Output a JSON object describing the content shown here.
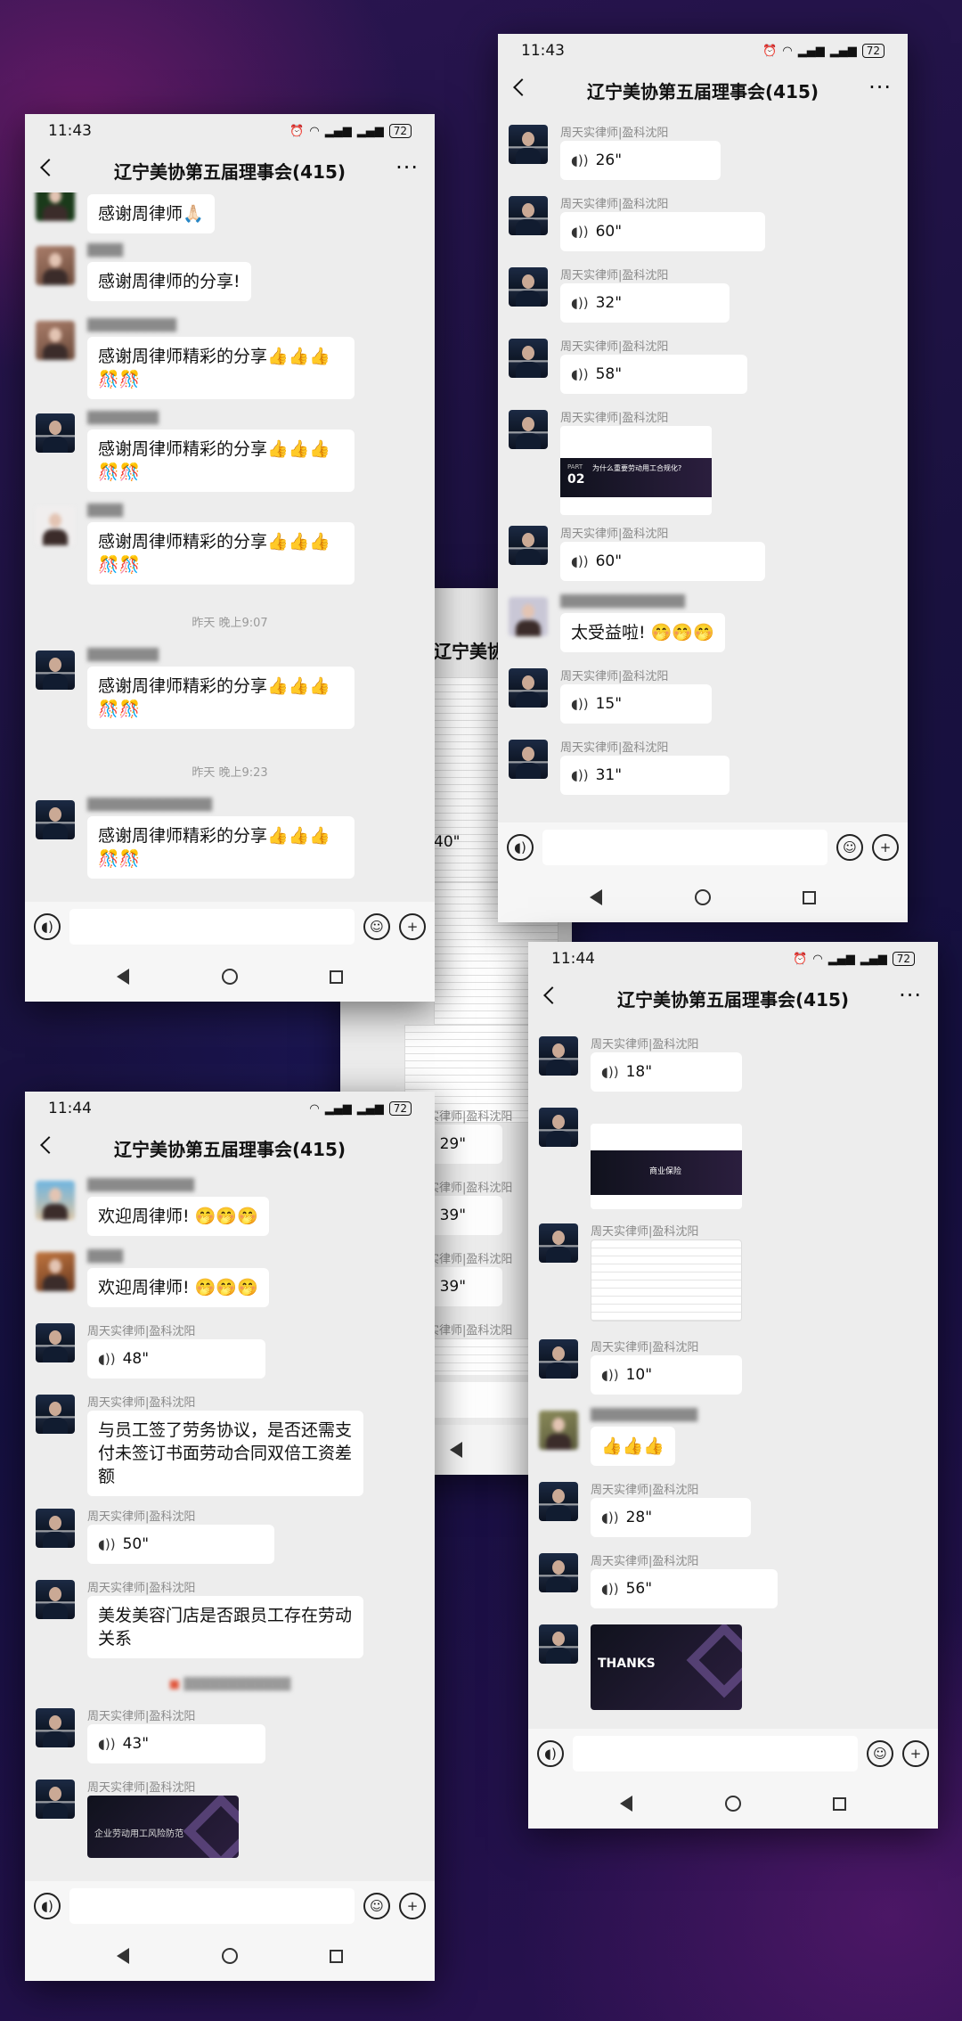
{
  "group_title": "辽宁美协第五届理事会(415)",
  "lawyer_name": "周天实律师|盈科沈阳",
  "phones": {
    "p1": {
      "time": "11:43",
      "battery": "72",
      "messages": [
        {
          "text": "感谢周律师🙏🏻"
        },
        {
          "text": "感谢周律师的分享!"
        },
        {
          "text": "感谢周律师精彩的分享👍👍👍🎊🎊"
        },
        {
          "text": "感谢周律师精彩的分享👍👍👍🎊🎊"
        },
        {
          "text": "感谢周律师精彩的分享👍👍👍🎊🎊"
        },
        {
          "text": "感谢周律师精彩的分享👍👍👍🎊🎊"
        },
        {
          "text": "感谢周律师精彩的分享👍👍👍🎊🎊"
        }
      ],
      "timestamps": [
        "昨天 晚上9:07",
        "昨天 晚上9:23"
      ]
    },
    "p2": {
      "time": "11:43",
      "battery": "72",
      "voice": [
        "26\"",
        "60\"",
        "32\"",
        "58\"",
        "60\"",
        "15\"",
        "31\""
      ],
      "slide_part": "PART",
      "slide_number": "02",
      "slide_text": "为什么重要劳动用工合规化?",
      "text_msg": "太受益啦! 🤭🤭🤭"
    },
    "p3": {
      "time": "11:44",
      "battery": "72",
      "messages": [
        {
          "text": "欢迎周律师! 🤭🤭🤭"
        },
        {
          "text": "欢迎周律师! 🤭🤭🤭"
        }
      ],
      "voice": [
        "48\"",
        "50\"",
        "43\""
      ],
      "question1": "与员工签了劳务协议，是否还需支付未签订书面劳动合同双倍工资差额",
      "question2": "美发美容门店是否跟员工存在劳动关系",
      "slide_text": "企业劳动用工风险防范"
    },
    "p4": {
      "voice": [
        "29\"",
        "39\"",
        "39\""
      ],
      "partial_title": "辽宁美协",
      "partial_voice": "40\""
    },
    "p5": {
      "time": "11:44",
      "battery": "72",
      "voice": [
        "18\"",
        "10\"",
        "28\"",
        "56\""
      ],
      "slide_text": "商业保险",
      "thumbs": "👍👍👍",
      "thanks": "THANKS"
    }
  }
}
